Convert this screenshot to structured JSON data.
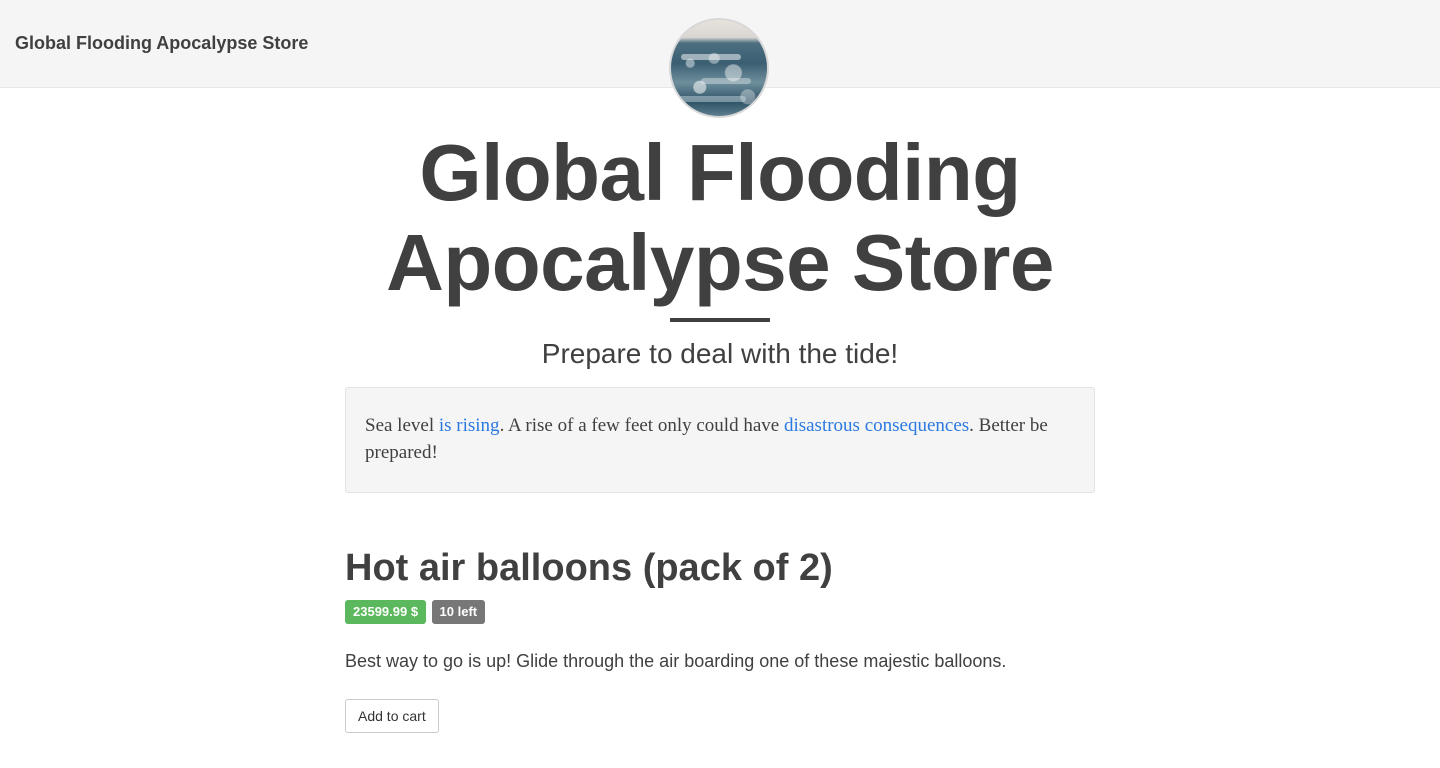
{
  "navbar": {
    "brand": "Global Flooding Apocalypse Store"
  },
  "hero": {
    "title_line1": "Global Flooding",
    "title_line2": "Apocalypse Store",
    "subtitle": "Prepare to deal with the tide!"
  },
  "notice": {
    "text_1": "Sea level ",
    "link_1": "is rising",
    "text_2": ". A rise of a few feet only could have ",
    "link_2": "disastrous consequences",
    "text_3": ". Better be prepared!"
  },
  "product": {
    "title": "Hot air balloons (pack of 2)",
    "price": "23599.99 $",
    "stock": "10 left",
    "description": "Best way to go is up! Glide through the air boarding one of these majestic balloons.",
    "add_to_cart": "Add to cart"
  },
  "colors": {
    "price_badge": "#5cb85c",
    "stock_badge": "#777777",
    "link": "#2a7ae2",
    "text": "#404040"
  }
}
